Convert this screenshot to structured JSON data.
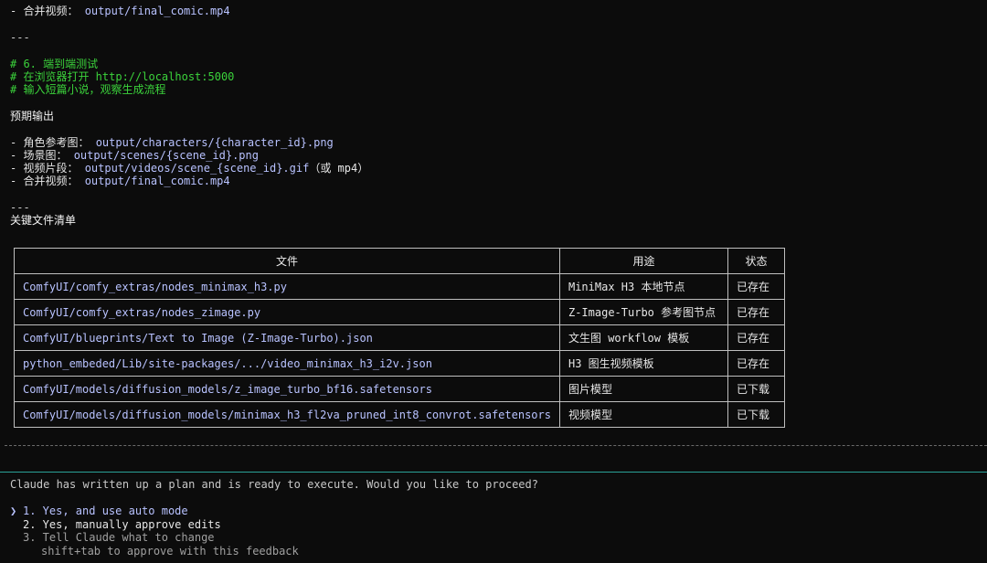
{
  "top_block": {
    "merge_label": "- 合并视频： ",
    "merge_path": "output/final_comic.mp4",
    "separator": "---"
  },
  "test_section": {
    "c1": "# 6. 端到端测试",
    "c2": "# 在浏览器打开 http://localhost:5000",
    "c3": "# 输入短篇小说，观察生成流程"
  },
  "expected": {
    "heading": "预期输出",
    "items": [
      {
        "label": "- 角色参考图： ",
        "path": "output/characters/{character_id}.png",
        "suffix": ""
      },
      {
        "label": "- 场景图： ",
        "path": "output/scenes/{scene_id}.png",
        "suffix": ""
      },
      {
        "label": "- 视频片段： ",
        "path": "output/videos/scene_{scene_id}.gif",
        "suffix": "（或 mp4）"
      },
      {
        "label": "- 合并视频： ",
        "path": "output/final_comic.mp4",
        "suffix": ""
      }
    ]
  },
  "files_section": {
    "separator": "---",
    "heading": "关键文件清单",
    "columns": [
      "文件",
      "用途",
      "状态"
    ],
    "rows": [
      {
        "file": "ComfyUI/comfy_extras/nodes_minimax_h3.py",
        "purpose": "MiniMax H3 本地节点",
        "status": "已存在"
      },
      {
        "file": "ComfyUI/comfy_extras/nodes_zimage.py",
        "purpose": "Z-Image-Turbo 参考图节点",
        "status": "已存在"
      },
      {
        "file": "ComfyUI/blueprints/Text to Image (Z-Image-Turbo).json",
        "purpose": "文生图 workflow 模板",
        "status": "已存在"
      },
      {
        "file": "python_embeded/Lib/site-packages/.../video_minimax_h3_i2v.json",
        "purpose": "H3 图生视频模板",
        "status": "已存在"
      },
      {
        "file": "ComfyUI/models/diffusion_models/z_image_turbo_bf16.safetensors",
        "purpose": "图片模型",
        "status": "已下载"
      },
      {
        "file": "ComfyUI/models/diffusion_models/minimax_h3_fl2va_pruned_int8_convrot.safetensors",
        "purpose": "视频模型",
        "status": "已下载"
      }
    ]
  },
  "prompt": {
    "question": "Claude has written up a plan and is ready to execute. Would you like to proceed?",
    "cursor": "❯",
    "options": [
      "1. Yes, and use auto mode",
      "2. Yes, manually approve edits",
      "3. Tell Claude what to change"
    ],
    "hint": "shift+tab to approve with this feedback"
  },
  "colors": {
    "background": "#0c0c0c",
    "path": "#b8c2ff",
    "comment": "#3bd23b",
    "accent_divider": "#2aa198"
  }
}
